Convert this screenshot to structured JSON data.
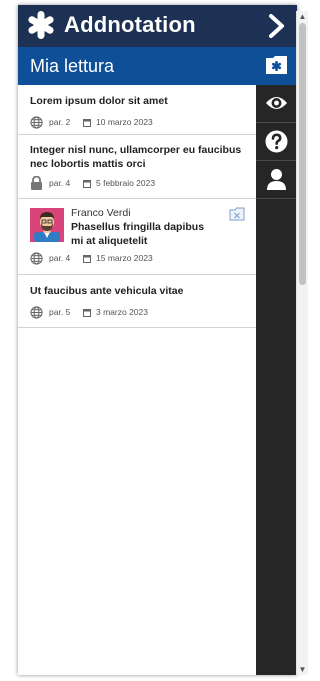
{
  "app": {
    "title": "Addnotation"
  },
  "section": {
    "title": "Mia lettura"
  },
  "items": [
    {
      "title": "Lorem ipsum dolor sit amet",
      "page": "par. 2",
      "date": "10 marzo 2023",
      "visibility": "globe-icon"
    },
    {
      "title": "Integer nisl nunc, ullamcorper eu faucibus nec lobortis mattis orci",
      "page": "par. 4",
      "date": "5 febbraio 2023",
      "visibility": "lock-icon"
    },
    {
      "author": "Franco Verdi",
      "title": "Phasellus fringilla dapibus mi at aliquetelit",
      "page": "par. 4",
      "date": "15 marzo 2023",
      "visibility": "globe-icon"
    },
    {
      "title": "Ut faucibus ante vehicula vitae",
      "page": "par. 5",
      "date": "3 marzo 2023",
      "visibility": "globe-icon"
    }
  ],
  "sidebar": [
    {
      "icon": "folder-asterisk-icon",
      "active": true
    },
    {
      "icon": "eye-icon",
      "active": false
    },
    {
      "icon": "help-icon",
      "active": false
    },
    {
      "icon": "user-icon",
      "active": false
    }
  ],
  "colors": {
    "header": "#1c3154",
    "accent": "#0e4f97",
    "sidebar": "#262626"
  }
}
